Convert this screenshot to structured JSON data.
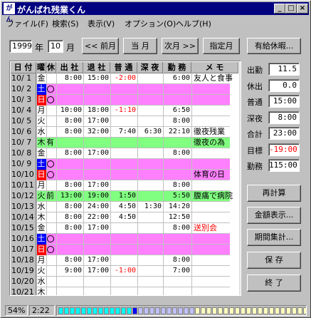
{
  "window": {
    "title": "がんばれ残業くん",
    "app_icon": "がん"
  },
  "title_buttons": {
    "minimize": "_",
    "maximize": "□",
    "close": "×"
  },
  "menu": [
    {
      "label": "ファイル(F)"
    },
    {
      "label": "検索(S)"
    },
    {
      "label": "表示(V)"
    },
    {
      "label": "オプション(O)"
    },
    {
      "label": "ヘルプ(H)"
    }
  ],
  "toolbar": {
    "year_value": "1999",
    "year_label": "年",
    "month_value": "10",
    "month_label": "月",
    "prev_month": "<< 前月",
    "this_month": "当 月",
    "next_month": "次月 >>",
    "specify_month": "指定月",
    "paid_leave": "有給休暇..."
  },
  "table": {
    "headers": [
      "日 付",
      "曜",
      "休",
      "出 社",
      "退 社",
      "普 通",
      "深 夜",
      "勤 務",
      "メ モ"
    ],
    "rows": [
      {
        "date": "10/ 1",
        "dow": "金",
        "dow_type": "weekday",
        "rest": "",
        "in": "8:00",
        "out": "15:00",
        "normal": "-2:00",
        "normal_neg": true,
        "night": "",
        "work": "6:00",
        "memo": "友人と食事",
        "memo_red": false,
        "hl": ""
      },
      {
        "date": "10/ 2",
        "dow": "土",
        "dow_type": "sat",
        "rest": "○",
        "in": "",
        "out": "",
        "normal": "",
        "normal_neg": false,
        "night": "",
        "work": "",
        "memo": "",
        "memo_red": false,
        "hl": "pink"
      },
      {
        "date": "10/ 3",
        "dow": "日",
        "dow_type": "sun",
        "rest": "○",
        "in": "",
        "out": "",
        "normal": "",
        "normal_neg": false,
        "night": "",
        "work": "",
        "memo": "",
        "memo_red": false,
        "hl": "pink"
      },
      {
        "date": "10/ 4",
        "dow": "月",
        "dow_type": "weekday",
        "rest": "",
        "in": "10:00",
        "out": "18:00",
        "normal": "-1:10",
        "normal_neg": true,
        "night": "",
        "work": "6:50",
        "memo": "",
        "memo_red": false,
        "hl": ""
      },
      {
        "date": "10/ 5",
        "dow": "火",
        "dow_type": "weekday",
        "rest": "",
        "in": "8:00",
        "out": "17:00",
        "normal": "",
        "normal_neg": false,
        "night": "",
        "work": "8:00",
        "memo": "",
        "memo_red": false,
        "hl": ""
      },
      {
        "date": "10/ 6",
        "dow": "水",
        "dow_type": "weekday",
        "rest": "",
        "in": "8:00",
        "out": "32:00",
        "normal": "7:40",
        "normal_neg": false,
        "night": "6:30",
        "work": "22:10",
        "memo": "徹夜残業",
        "memo_red": false,
        "hl": ""
      },
      {
        "date": "10/ 7",
        "dow": "木",
        "dow_type": "weekday",
        "rest": "有",
        "in": "",
        "out": "",
        "normal": "",
        "normal_neg": false,
        "night": "",
        "work": "",
        "memo": "徹夜の為",
        "memo_red": false,
        "hl": "green"
      },
      {
        "date": "10/ 8",
        "dow": "金",
        "dow_type": "weekday",
        "rest": "",
        "in": "8:00",
        "out": "17:00",
        "normal": "",
        "normal_neg": false,
        "night": "",
        "work": "8:00",
        "memo": "",
        "memo_red": false,
        "hl": ""
      },
      {
        "date": "10/ 9",
        "dow": "土",
        "dow_type": "sat",
        "rest": "○",
        "in": "",
        "out": "",
        "normal": "",
        "normal_neg": false,
        "night": "",
        "work": "",
        "memo": "",
        "memo_red": false,
        "hl": "pink"
      },
      {
        "date": "10/10",
        "dow": "日",
        "dow_type": "sun",
        "rest": "○",
        "in": "",
        "out": "",
        "normal": "",
        "normal_neg": false,
        "night": "",
        "work": "",
        "memo": "体育の日",
        "memo_red": false,
        "hl": "pink"
      },
      {
        "date": "10/11",
        "dow": "月",
        "dow_type": "weekday",
        "rest": "",
        "in": "8:00",
        "out": "17:00",
        "normal": "",
        "normal_neg": false,
        "night": "",
        "work": "8:00",
        "memo": "",
        "memo_red": false,
        "hl": ""
      },
      {
        "date": "10/12",
        "dow": "火",
        "dow_type": "weekday",
        "rest": "前",
        "in": "13:00",
        "out": "19:00",
        "normal": "1:50",
        "normal_neg": false,
        "night": "",
        "work": "5:50",
        "memo": "腹痛で病院",
        "memo_red": false,
        "hl": "green"
      },
      {
        "date": "10/13",
        "dow": "水",
        "dow_type": "weekday",
        "rest": "",
        "in": "8:00",
        "out": "24:00",
        "normal": "4:50",
        "normal_neg": false,
        "night": "1:30",
        "work": "14:20",
        "memo": "",
        "memo_red": false,
        "hl": ""
      },
      {
        "date": "10/14",
        "dow": "木",
        "dow_type": "weekday",
        "rest": "",
        "in": "8:00",
        "out": "22:00",
        "normal": "4:50",
        "normal_neg": false,
        "night": "",
        "work": "12:50",
        "memo": "",
        "memo_red": false,
        "hl": ""
      },
      {
        "date": "10/15",
        "dow": "金",
        "dow_type": "weekday",
        "rest": "",
        "in": "8:00",
        "out": "17:00",
        "normal": "",
        "normal_neg": false,
        "night": "",
        "work": "8:00",
        "memo": "送別会",
        "memo_red": true,
        "hl": ""
      },
      {
        "date": "10/16",
        "dow": "土",
        "dow_type": "sat",
        "rest": "○",
        "in": "",
        "out": "",
        "normal": "",
        "normal_neg": false,
        "night": "",
        "work": "",
        "memo": "",
        "memo_red": false,
        "hl": "pink"
      },
      {
        "date": "10/17",
        "dow": "日",
        "dow_type": "sun",
        "rest": "○",
        "in": "",
        "out": "",
        "normal": "",
        "normal_neg": false,
        "night": "",
        "work": "",
        "memo": "",
        "memo_red": false,
        "hl": "pink"
      },
      {
        "date": "10/18",
        "dow": "月",
        "dow_type": "weekday",
        "rest": "",
        "in": "8:00",
        "out": "17:00",
        "normal": "",
        "normal_neg": false,
        "night": "",
        "work": "8:00",
        "memo": "",
        "memo_red": false,
        "hl": ""
      },
      {
        "date": "10/19",
        "dow": "火",
        "dow_type": "weekday",
        "rest": "",
        "in": "9:00",
        "out": "17:00",
        "normal": "-1:00",
        "normal_neg": true,
        "night": "",
        "work": "7:00",
        "memo": "",
        "memo_red": false,
        "hl": ""
      },
      {
        "date": "10/20",
        "dow": "水",
        "dow_type": "weekday",
        "rest": "",
        "in": "",
        "out": "",
        "normal": "",
        "normal_neg": false,
        "night": "",
        "work": "",
        "memo": "",
        "memo_red": false,
        "hl": ""
      },
      {
        "date": "10/21",
        "dow": "木",
        "dow_type": "weekday",
        "rest": "",
        "in": "",
        "out": "",
        "normal": "",
        "normal_neg": false,
        "night": "",
        "work": "",
        "memo": "",
        "memo_red": false,
        "hl": ""
      }
    ]
  },
  "summary": [
    {
      "label": "出勤",
      "value": "11.5",
      "red": false
    },
    {
      "label": "休出",
      "value": "0.0",
      "red": false
    },
    {
      "label": "普通",
      "value": "15:00",
      "red": false
    },
    {
      "label": "深夜",
      "value": "8:00",
      "red": false
    },
    {
      "label": "合計",
      "value": "23:00",
      "red": false
    },
    {
      "label": "目標",
      "value": "-19:00",
      "red": true
    },
    {
      "label": "勤務",
      "value": "115:00",
      "red": false
    }
  ],
  "actions": {
    "recalc": "再計算",
    "amount": "金額表示...",
    "period": "期間集計...",
    "save": "保 存",
    "exit": "終 了"
  },
  "status": {
    "percent": "54%",
    "time": "2:22",
    "progress": 0.54
  },
  "colors": {
    "title_bg": "#000080",
    "pink": "#ff80ff",
    "green": "#80ff80",
    "sat": "#0000ff",
    "sun": "#ff0000",
    "negative": "#ff0000",
    "prog_cyan": "#00ffff",
    "prog_blue": "#0000ff",
    "prog_lav": "#c0c0ff",
    "prog_yellow": "#ffffc0"
  }
}
